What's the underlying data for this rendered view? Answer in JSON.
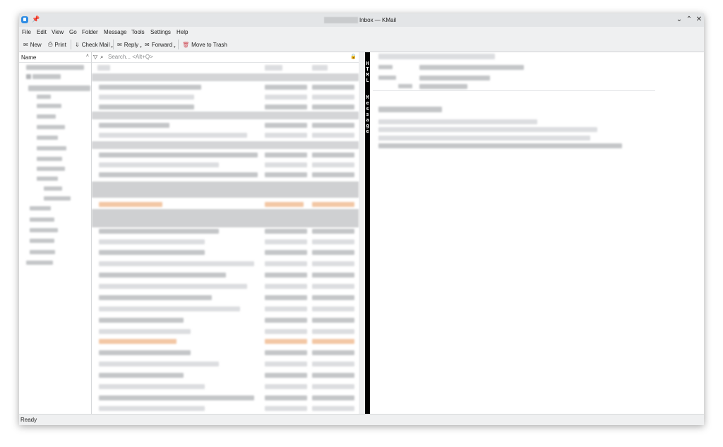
{
  "window": {
    "title": "Inbox — KMail",
    "controls": {
      "minimize": "⌄",
      "maximize": "⌃",
      "close": "✕"
    }
  },
  "menu": [
    "File",
    "Edit",
    "View",
    "Go",
    "Folder",
    "Message",
    "Tools",
    "Settings",
    "Help"
  ],
  "toolbar": {
    "new_label": "New",
    "print_label": "Print",
    "check_mail_label": "Check Mail",
    "reply_label": "Reply",
    "forward_label": "Forward",
    "trash_label": "Move to Trash"
  },
  "folder_pane": {
    "header": "Name"
  },
  "message_list": {
    "search_placeholder": "Search... <Alt+Q>"
  },
  "reader": {
    "html_banner": "HTML Message"
  },
  "status": {
    "text": "Ready"
  },
  "colors": {
    "accent": "#2f8de4",
    "highlight": "#f3c7a4",
    "html_bar": "#000000"
  }
}
